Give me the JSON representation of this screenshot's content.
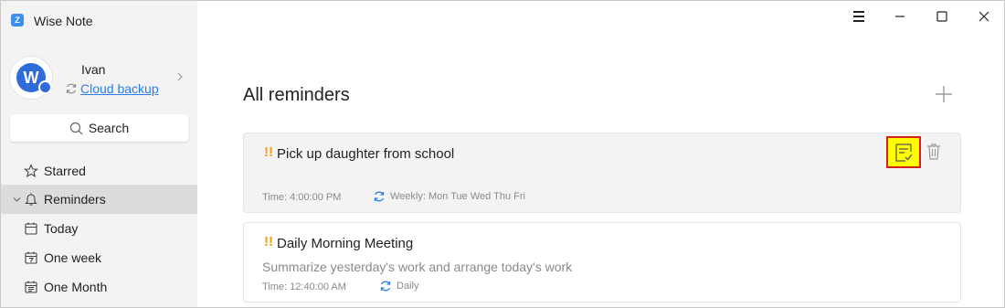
{
  "app": {
    "title": "Wise Note",
    "logo_glyph": "Z"
  },
  "user": {
    "name": "Ivan",
    "avatar_initial": "W",
    "backup_link": "Cloud backup"
  },
  "sidebar": {
    "search_label": "Search",
    "items": [
      {
        "label": "Starred",
        "icon": "star-icon"
      },
      {
        "label": "Reminders",
        "icon": "bell-icon",
        "active": true
      },
      {
        "label": "Today",
        "icon": "calendar-icon"
      },
      {
        "label": "One week",
        "icon": "calendar-7-icon"
      },
      {
        "label": "One Month",
        "icon": "calendar-month-icon"
      }
    ]
  },
  "main": {
    "title": "All reminders",
    "reminders": [
      {
        "priority": "!!",
        "title": "Pick up daughter from school",
        "subtitle": "",
        "time": "Time: 4:00:00 PM",
        "repeat": "Weekly: Mon Tue Wed Thu Fri",
        "selected": true
      },
      {
        "priority": "!!",
        "title": "Daily Morning Meeting",
        "subtitle": "Summarize yesterday's work and arrange today's work",
        "time": "Time: 12:40:00 AM",
        "repeat": "Daily",
        "selected": false
      }
    ]
  },
  "colors": {
    "accent": "#2b7de9",
    "priority": "#f39c12",
    "highlight": "#ffff00",
    "highlight_border": "#d62020",
    "sidebar_bg": "#f3f3f3",
    "active_item_bg": "#dcdcdc"
  }
}
